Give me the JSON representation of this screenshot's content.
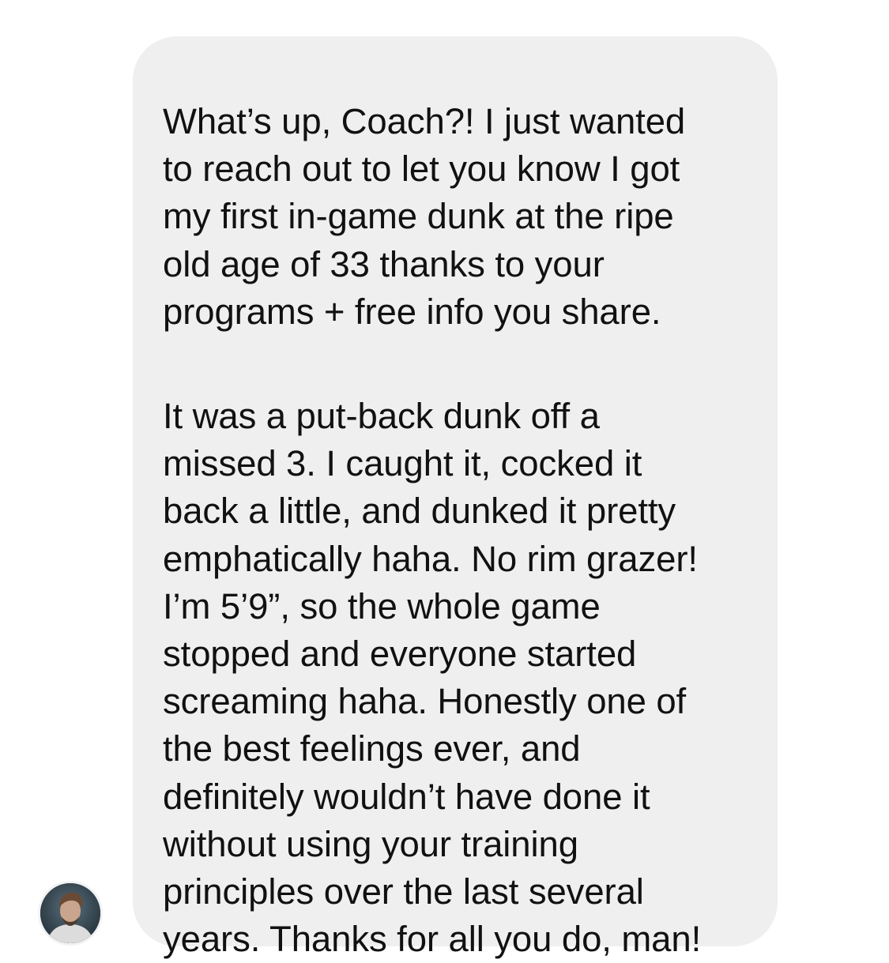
{
  "message": {
    "sender_avatar_icon": "profile-photo-icon",
    "paragraphs": [
      "What’s up, Coach?! I just wanted\nto reach out to let you know I got\nmy first in-game dunk at the ripe\nold age of 33 thanks to your\nprograms + free info you share.",
      "It was a put-back dunk off a\nmissed 3. I caught it, cocked it\nback a little, and dunked it pretty\nemphatically haha. No rim grazer!\nI’m 5’9”, so the whole game\nstopped and everyone started\nscreaming haha. Honestly one of\nthe best feelings ever, and\ndefinitely wouldn’t have done it\nwithout using your training\nprinciples over the last several\nyears. Thanks for all you do, man!"
    ]
  },
  "colors": {
    "bubble_background": "#efeff0",
    "text": "#111111",
    "page_background": "#ffffff"
  }
}
